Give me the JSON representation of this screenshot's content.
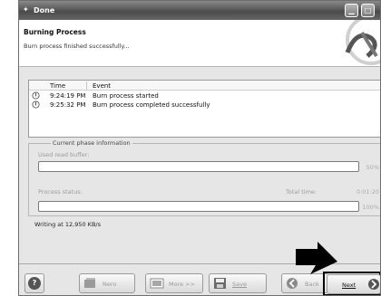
{
  "window": {
    "title": "Done"
  },
  "header": {
    "title": "Burning Process",
    "subtitle": "Burn process finished successfully..."
  },
  "log": {
    "columns": {
      "time": "Time",
      "event": "Event"
    },
    "rows": [
      {
        "time": "9:24:19 PM",
        "event": "Burn process started"
      },
      {
        "time": "9:25:32 PM",
        "event": "Burn process completed successfully"
      }
    ]
  },
  "phase": {
    "legend": "Current phase information",
    "buffer_label": "Used read buffer:",
    "buffer_percent": "50%",
    "status_label": "Process status:",
    "total_time_label": "Total time:",
    "total_time_value": "0:01:20",
    "status_percent": "100%"
  },
  "writing_text": "Writing at 12,950 KB/s",
  "footer": {
    "nero_label": "Nero",
    "more_label": "More >>",
    "save_label": "Save",
    "back_label": "Back",
    "next_label": "Next"
  },
  "colors": {
    "titlebar": "#5a5a5a",
    "panel": "#e6e6e6",
    "highlight_frame": "#000000"
  }
}
